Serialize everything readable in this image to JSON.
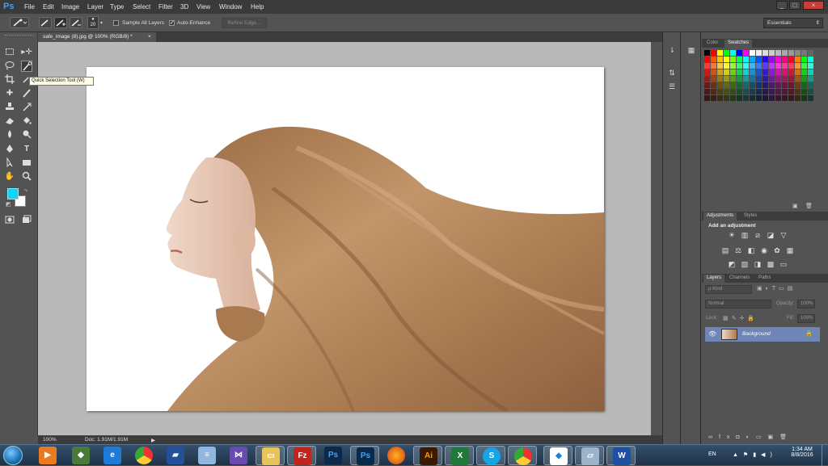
{
  "app": {
    "logo": "Ps",
    "menu": [
      "File",
      "Edit",
      "Image",
      "Layer",
      "Type",
      "Select",
      "Filter",
      "3D",
      "View",
      "Window",
      "Help"
    ],
    "window_controls": [
      "_",
      "□",
      "×"
    ]
  },
  "options_bar": {
    "brush_size": "20",
    "sample_all_layers_label": "Sample All Layers",
    "sample_all_layers_checked": false,
    "auto_enhance_label": "Auto-Enhance",
    "auto_enhance_checked": true,
    "refine_edge_label": "Refine Edge...",
    "workspace": "Essentials"
  },
  "document": {
    "tab_title": "safe_image (8).jpg @ 100% (RGB/8) *",
    "tab_close": "×",
    "zoom": "100%",
    "doc_info": "Doc: 1.91M/1.91M",
    "status_arrow": "▶"
  },
  "tooltip": "Quick Selection Tool (W)",
  "toolbar": {
    "foreground_color": "#00d8ff",
    "background_color": "#ffffff"
  },
  "panels": {
    "color_tabs": [
      "Color",
      "Swatches"
    ],
    "adjustments_tabs": [
      "Adjustments",
      "Styles"
    ],
    "adjustments_heading": "Add an adjustment",
    "layers_tabs": [
      "Layers",
      "Channels",
      "Paths"
    ],
    "kind_label": "ρ Kind",
    "blend_mode": "Normal",
    "opacity_label": "Opacity:",
    "opacity_value": "100%",
    "lock_label": "Lock:",
    "fill_label": "Fill:",
    "fill_value": "100%",
    "layer_name": "Background"
  },
  "taskbar": {
    "language": "EN",
    "time": "1:34 AM",
    "date": "8/8/2016"
  },
  "colors": {
    "accent": "#3fa2ff",
    "layer_selected": "#6d86b5",
    "hair": "#b58458"
  }
}
